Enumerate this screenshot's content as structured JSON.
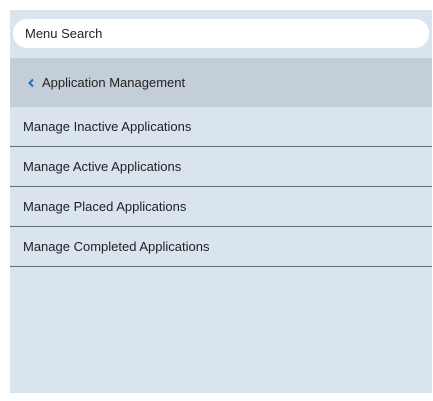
{
  "search": {
    "placeholder": "Menu Search"
  },
  "section": {
    "title": "Application Management",
    "back_icon": "chevron-left-icon"
  },
  "menu": {
    "items": [
      {
        "label": "Manage Inactive Applications"
      },
      {
        "label": "Manage Active Applications"
      },
      {
        "label": "Manage Placed Applications"
      },
      {
        "label": "Manage Completed Applications"
      }
    ]
  },
  "colors": {
    "panel_bg": "#d9e4ee",
    "header_bg": "#c4ced8",
    "chevron": "#2f6fb3",
    "divider": "#5f6f7e"
  }
}
